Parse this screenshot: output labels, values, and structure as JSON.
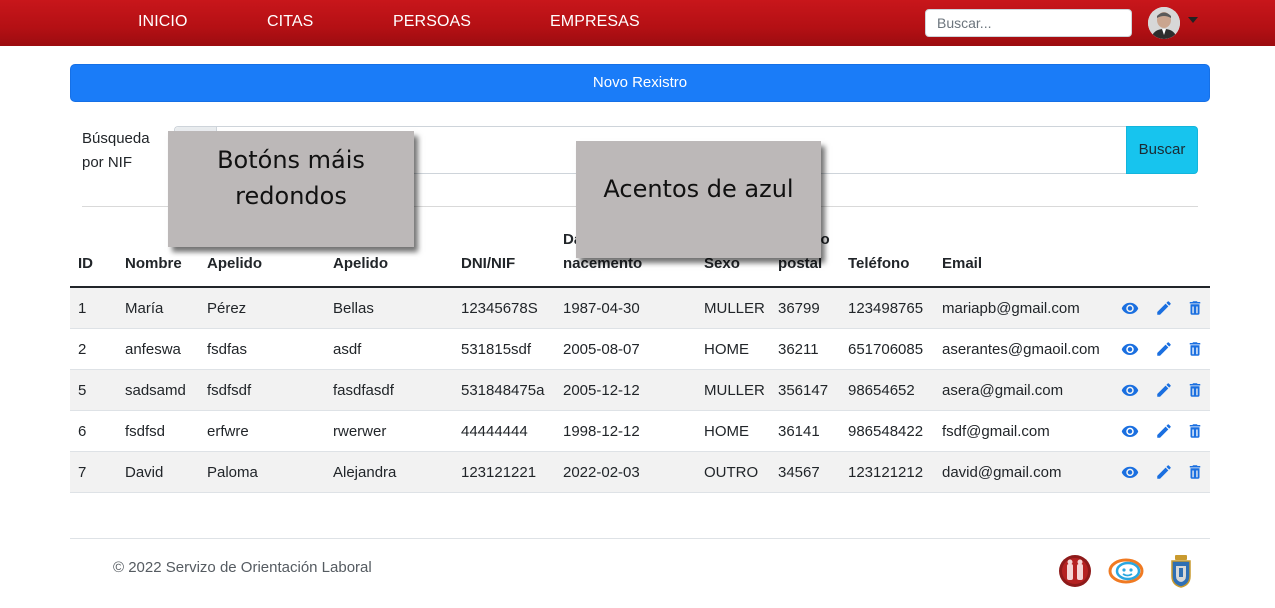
{
  "nav": {
    "items": [
      "INICIO",
      "CITAS",
      "PERSOAS",
      "EMPRESAS"
    ],
    "search_placeholder": "Buscar..."
  },
  "new_record_label": "Novo Rexistro",
  "nif_search": {
    "label": "Búsqueda por NIF",
    "button_label": "Buscar"
  },
  "annotations": {
    "note1": "Botóns máis redondos",
    "note2": "Acentos de azul"
  },
  "table": {
    "headers": [
      "ID",
      "Nombre",
      "Primeiro Apelido",
      "Segundo Apelido",
      "DNI/NIF",
      "Data de nacemento",
      "Sexo",
      "Código postal",
      "Teléfono",
      "Email"
    ],
    "rows": [
      [
        "1",
        "María",
        "Pérez",
        "Bellas",
        "12345678S",
        "1987-04-30",
        "MULLER",
        "36799",
        "123498765",
        "mariapb@gmail.com"
      ],
      [
        "2",
        "anfeswa",
        "fsdfas",
        "asdf",
        "531815sdf",
        "2005-08-07",
        "HOME",
        "36211",
        "651706085",
        "aserantes@gmaoil.com"
      ],
      [
        "5",
        "sadsamd",
        "fsdfsdf",
        "fasdfasdf",
        "531848475a",
        "2005-12-12",
        "MULLER",
        "356147",
        "98654652",
        "asera@gmail.com"
      ],
      [
        "6",
        "fsdfsd",
        "erfwre",
        "rwerwer",
        "44444444",
        "1998-12-12",
        "HOME",
        "36141",
        "986548422",
        "fsdf@gmail.com"
      ],
      [
        "7",
        "David",
        "Paloma",
        "Alejandra",
        "123121221",
        "2022-02-03",
        "OUTRO",
        "34567",
        "123121212",
        "david@gmail.com"
      ]
    ],
    "row_actions": [
      "eye-icon",
      "pencil-icon",
      "trash-icon"
    ]
  },
  "footer": {
    "copyright": "© 2022 Servizo de Orientación Laboral",
    "logos": [
      "partner-logo-red",
      "chat-faces-logo",
      "coat-of-arms-logo"
    ]
  },
  "colors": {
    "navbar": "#b41014",
    "primary_button": "#1a7cf8",
    "info_button": "#17c4ee",
    "action_icons": "#1a6fe0",
    "note_background": "#bcb8b8"
  }
}
